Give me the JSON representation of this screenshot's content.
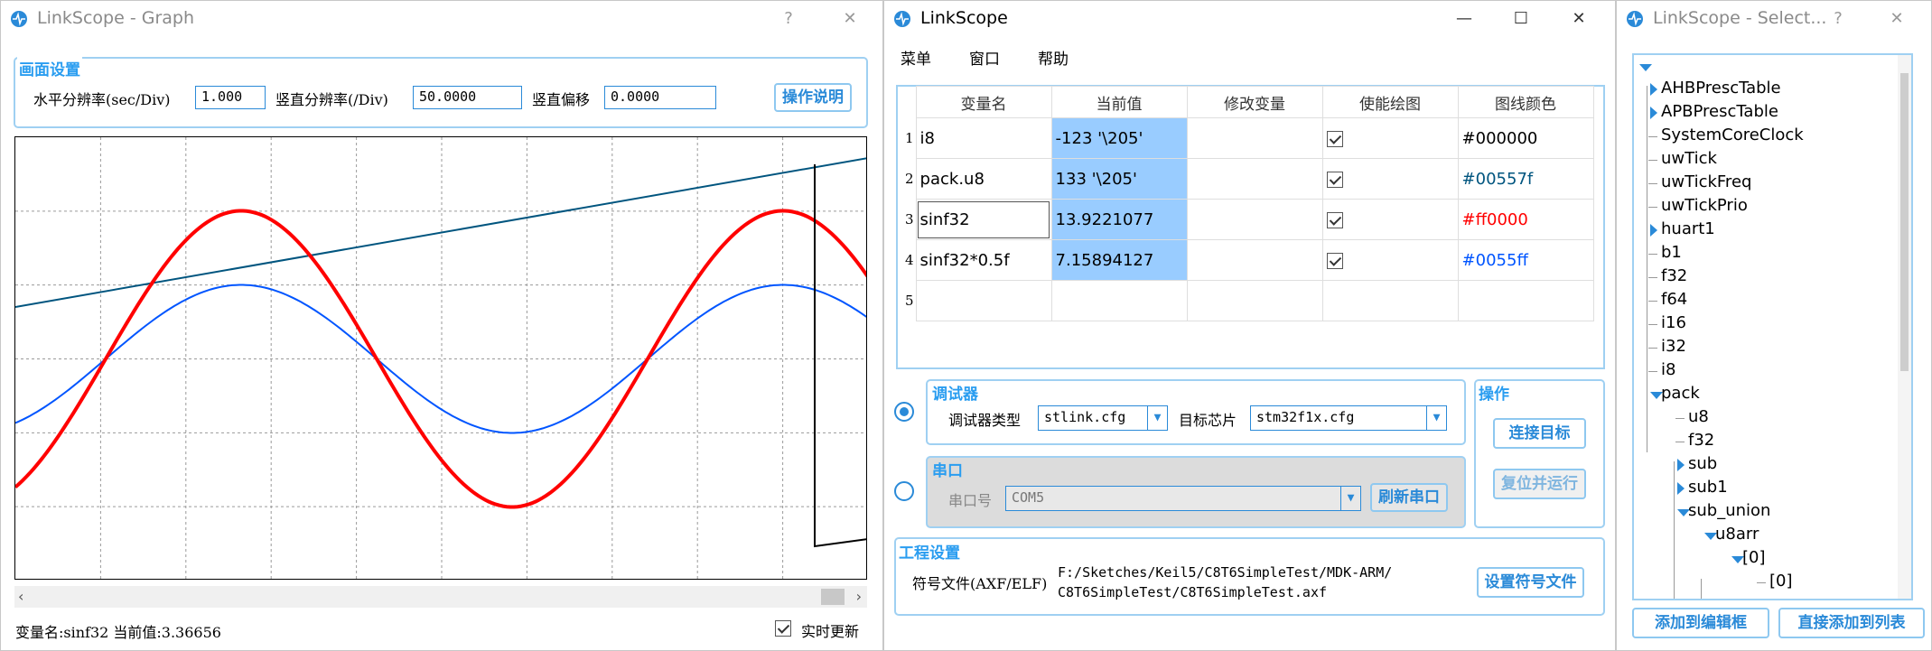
{
  "graph_window": {
    "title": "LinkScope - Graph",
    "help_glyph": "?",
    "close_glyph": "✕",
    "screen_settings": {
      "title": "画面设置",
      "h_res_label": "水平分辨率(sec/Div)",
      "h_res_value": "1.000",
      "v_res_label": "竖直分辨率(/Div)",
      "v_res_value": "50.0000",
      "v_offset_label": "竖直偏移",
      "v_offset_value": "0.0000",
      "help_button": "操作说明"
    },
    "status_text": "变量名:sinf32 当前值:3.36656",
    "realtime_label": "实时更新",
    "realtime_checked": true,
    "plot_colors": {
      "red": "#ff0000",
      "blue": "#0055ff",
      "teal": "#00557f",
      "black": "#000000"
    }
  },
  "main_window": {
    "title": "LinkScope",
    "menu": [
      "菜单",
      "窗口",
      "帮助"
    ],
    "table": {
      "headers": [
        "变量名",
        "当前值",
        "修改变量",
        "使能绘图",
        "图线颜色"
      ],
      "rows": [
        {
          "index": "1",
          "name": "i8",
          "value": "-123 '\\205'",
          "modify": "",
          "plot": true,
          "color": "#000000",
          "color_hex": "#000000"
        },
        {
          "index": "2",
          "name": "pack.u8",
          "value": "133 '\\205'",
          "modify": "",
          "plot": true,
          "color": "#00557f",
          "color_hex": "#00557f"
        },
        {
          "index": "3",
          "name": "sinf32",
          "value": "13.9221077",
          "modify": "",
          "plot": true,
          "color": "#ff0000",
          "color_hex": "#ff0000"
        },
        {
          "index": "4",
          "name": "sinf32*0.5f",
          "value": "7.15894127",
          "modify": "",
          "plot": true,
          "color": "#0055ff",
          "color_hex": "#0055ff"
        },
        {
          "index": "5",
          "name": "",
          "value": "",
          "modify": "",
          "plot": null,
          "color": "",
          "color_hex": "#000000"
        }
      ]
    },
    "debugger": {
      "title": "调试器",
      "type_label": "调试器类型",
      "type_value": "stlink.cfg",
      "chip_label": "目标芯片",
      "chip_value": "stm32f1x.cfg",
      "selected": true
    },
    "serial": {
      "title": "串口",
      "port_label": "串口号",
      "port_value": "COM5",
      "refresh_button": "刷新串口",
      "selected": false
    },
    "operations": {
      "title": "操作",
      "connect_button": "连接目标",
      "reset_button": "复位并运行"
    },
    "project": {
      "title": "工程设置",
      "symbol_label": "符号文件(AXF/ELF)",
      "symbol_path_line1": "F:/Sketches/Keil5/C8T6SimpleTest/MDK-ARM/",
      "symbol_path_line2": "C8T6SimpleTest/C8T6SimpleTest.axf",
      "set_button": "设置符号文件"
    }
  },
  "select_window": {
    "title": "LinkScope - Select...",
    "help_glyph": "?",
    "close_glyph": "✕",
    "tree": [
      {
        "label": "AHBPrescTable",
        "indent": 1,
        "expander": "collapsed"
      },
      {
        "label": "APBPrescTable",
        "indent": 1,
        "expander": "collapsed"
      },
      {
        "label": "SystemCoreClock",
        "indent": 1,
        "expander": "none"
      },
      {
        "label": "uwTick",
        "indent": 1,
        "expander": "none"
      },
      {
        "label": "uwTickFreq",
        "indent": 1,
        "expander": "none"
      },
      {
        "label": "uwTickPrio",
        "indent": 1,
        "expander": "none"
      },
      {
        "label": "huart1",
        "indent": 1,
        "expander": "collapsed"
      },
      {
        "label": "b1",
        "indent": 1,
        "expander": "none"
      },
      {
        "label": "f32",
        "indent": 1,
        "expander": "none"
      },
      {
        "label": "f64",
        "indent": 1,
        "expander": "none"
      },
      {
        "label": "i16",
        "indent": 1,
        "expander": "none"
      },
      {
        "label": "i32",
        "indent": 1,
        "expander": "none"
      },
      {
        "label": "i8",
        "indent": 1,
        "expander": "none"
      },
      {
        "label": "pack",
        "indent": 1,
        "expander": "expanded"
      },
      {
        "label": "u8",
        "indent": 2,
        "expander": "none"
      },
      {
        "label": "f32",
        "indent": 2,
        "expander": "none"
      },
      {
        "label": "sub",
        "indent": 2,
        "expander": "collapsed"
      },
      {
        "label": "sub1",
        "indent": 2,
        "expander": "collapsed"
      },
      {
        "label": "sub_union",
        "indent": 2,
        "expander": "expanded"
      },
      {
        "label": "u8arr",
        "indent": 3,
        "expander": "expanded"
      },
      {
        "label": "[0]",
        "indent": 4,
        "expander": "expanded"
      },
      {
        "label": "[0]",
        "indent": 5,
        "expander": "none"
      }
    ],
    "add_to_editor_button": "添加到编辑框",
    "add_to_list_button": "直接添加到列表"
  },
  "window_controls": {
    "minimize": "—",
    "maximize": "☐",
    "close": "✕"
  }
}
